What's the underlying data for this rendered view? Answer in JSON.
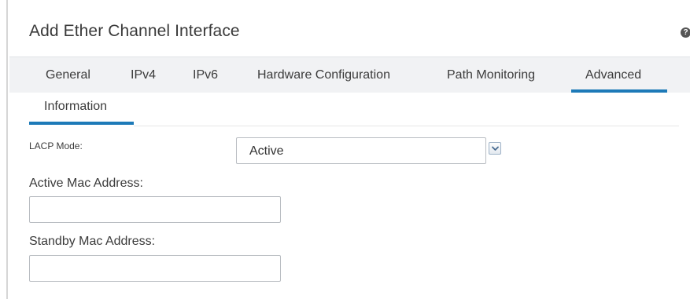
{
  "dialog": {
    "title": "Add Ether Channel Interface",
    "help_icon": "help-icon"
  },
  "tabs": [
    {
      "label": "General",
      "selected": false
    },
    {
      "label": "IPv4",
      "selected": false
    },
    {
      "label": "IPv6",
      "selected": false
    },
    {
      "label": "Hardware Configuration",
      "selected": false
    },
    {
      "label": "Path Monitoring",
      "selected": false
    },
    {
      "label": "Advanced",
      "selected": true
    }
  ],
  "subtabs": [
    {
      "label": "Information",
      "selected": true
    }
  ],
  "form": {
    "lacp_mode": {
      "label": "LACP Mode:",
      "value": "Active",
      "icon": "chevron-down-icon"
    },
    "active_mac": {
      "label": "Active Mac Address:",
      "value": "",
      "placeholder": ""
    },
    "standby_mac": {
      "label": "Standby Mac Address:",
      "value": "",
      "placeholder": ""
    }
  },
  "colors": {
    "accent": "#1d7ab8",
    "tab_bar_bg": "#f1f2f4",
    "text": "#3b3b3b",
    "border": "#b9bdc2"
  }
}
